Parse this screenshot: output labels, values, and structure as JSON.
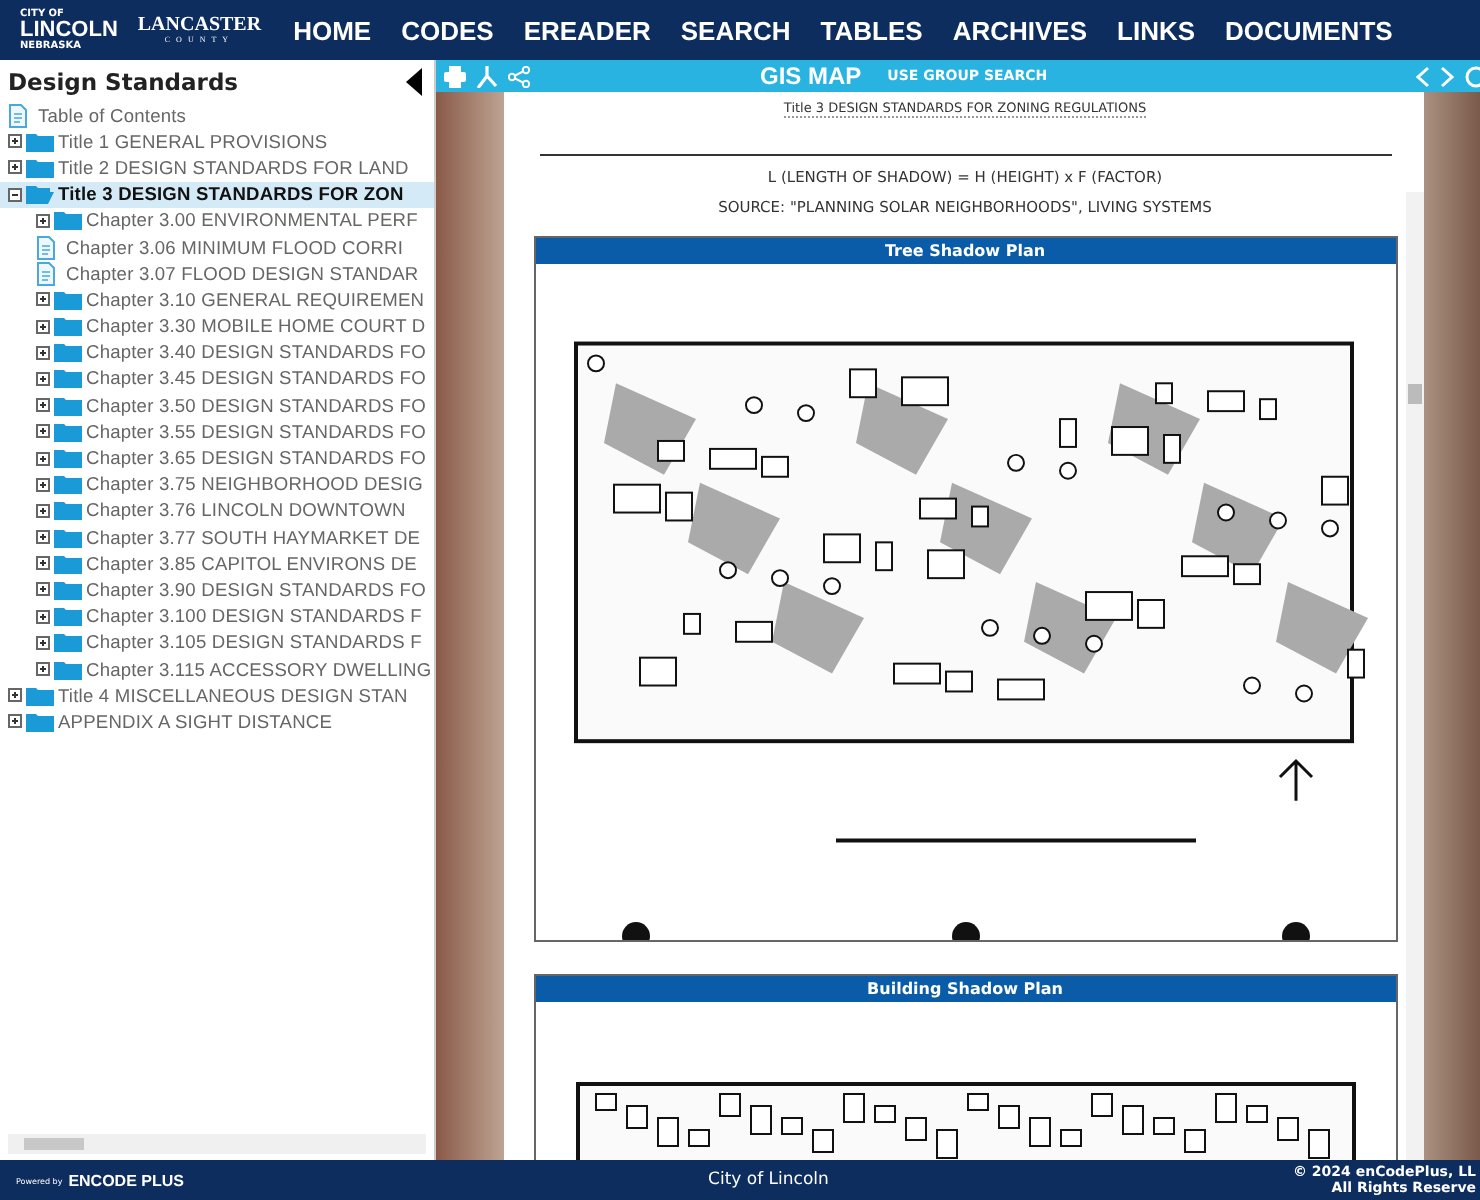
{
  "header": {
    "logo": {
      "city_of": "CITY OF",
      "lincoln": "LINCOLN",
      "nebraska": "NEBRASKA",
      "lancaster": "LANCASTER",
      "county": "COUNTY"
    },
    "nav": [
      "HOME",
      "CODES",
      "EREADER",
      "SEARCH",
      "TABLES",
      "ARCHIVES",
      "LINKS",
      "DOCUMENTS"
    ]
  },
  "sidebar": {
    "title": "Design Standards",
    "items": [
      {
        "kind": "document",
        "label": "Table of Contents",
        "selected": false
      },
      {
        "kind": "folder",
        "label": "Title 1 GENERAL PROVISIONS",
        "expanded": false,
        "selected": false
      },
      {
        "kind": "folder",
        "label": "Title 2 DESIGN STANDARDS FOR LAND",
        "expanded": false,
        "selected": false
      },
      {
        "kind": "folder",
        "label": "Title 3 DESIGN STANDARDS FOR ZON",
        "expanded": true,
        "selected": true,
        "children": [
          {
            "kind": "folder",
            "label": "Chapter 3.00 ENVIRONMENTAL PERF",
            "expanded": false,
            "selected": false
          },
          {
            "kind": "document",
            "label": "Chapter 3.06 MINIMUM FLOOD CORRI",
            "selected": false
          },
          {
            "kind": "document",
            "label": "Chapter 3.07 FLOOD DESIGN STANDAR",
            "selected": false
          },
          {
            "kind": "folder",
            "label": "Chapter 3.10 GENERAL REQUIREMEN",
            "expanded": false,
            "selected": false
          },
          {
            "kind": "folder",
            "label": "Chapter 3.30 MOBILE HOME COURT D",
            "expanded": false,
            "selected": false
          },
          {
            "kind": "folder",
            "label": "Chapter 3.40 DESIGN STANDARDS FO",
            "expanded": false,
            "selected": false
          },
          {
            "kind": "folder",
            "label": "Chapter 3.45 DESIGN STANDARDS FO",
            "expanded": false,
            "selected": false
          },
          {
            "kind": "folder",
            "label": "Chapter 3.50 DESIGN STANDARDS FO",
            "expanded": false,
            "selected": false
          },
          {
            "kind": "folder",
            "label": "Chapter 3.55 DESIGN STANDARDS FO",
            "expanded": false,
            "selected": false
          },
          {
            "kind": "folder",
            "label": "Chapter 3.65 DESIGN STANDARDS FO",
            "expanded": false,
            "selected": false
          },
          {
            "kind": "folder",
            "label": "Chapter 3.75 NEIGHBORHOOD DESIG",
            "expanded": false,
            "selected": false
          },
          {
            "kind": "folder",
            "label": "Chapter 3.76 LINCOLN DOWNTOWN",
            "expanded": false,
            "selected": false
          },
          {
            "kind": "folder",
            "label": "Chapter 3.77 SOUTH HAYMARKET DE",
            "expanded": false,
            "selected": false
          },
          {
            "kind": "folder",
            "label": "Chapter 3.85 CAPITOL ENVIRONS DE",
            "expanded": false,
            "selected": false
          },
          {
            "kind": "folder",
            "label": "Chapter 3.90 DESIGN STANDARDS FO",
            "expanded": false,
            "selected": false
          },
          {
            "kind": "folder",
            "label": "Chapter 3.100 DESIGN STANDARDS F",
            "expanded": false,
            "selected": false
          },
          {
            "kind": "folder",
            "label": "Chapter 3.105 DESIGN STANDARDS F",
            "expanded": false,
            "selected": false
          },
          {
            "kind": "folder",
            "label": "Chapter 3.115 ACCESSORY DWELLING",
            "expanded": false,
            "selected": false
          }
        ]
      },
      {
        "kind": "folder",
        "label": "Title 4 MISCELLANEOUS DESIGN STAN",
        "expanded": false,
        "selected": false
      },
      {
        "kind": "folder",
        "label": "APPENDIX A SIGHT DISTANCE",
        "expanded": false,
        "selected": false
      }
    ]
  },
  "toolbar": {
    "gis_map": "GIS MAP",
    "group_search": "USE GROUP SEARCH"
  },
  "document": {
    "heading": "Title 3 DESIGN STANDARDS FOR ZONING REGULATIONS",
    "lines": [
      "L (LENGTH OF SHADOW) = H (HEIGHT) x F (FACTOR)",
      "SOURCE: \"PLANNING SOLAR NEIGHBORHOODS\", LIVING SYSTEMS"
    ],
    "figures": [
      {
        "title": "Tree Shadow Plan"
      },
      {
        "title": "Building Shadow Plan"
      }
    ]
  },
  "footer": {
    "powered_by": "Powered by",
    "brand": "ENCODE PLUS",
    "center": "City of Lincoln",
    "copyright": "© 2024 enCodePlus, LL",
    "rights": "All Rights Reserve"
  }
}
